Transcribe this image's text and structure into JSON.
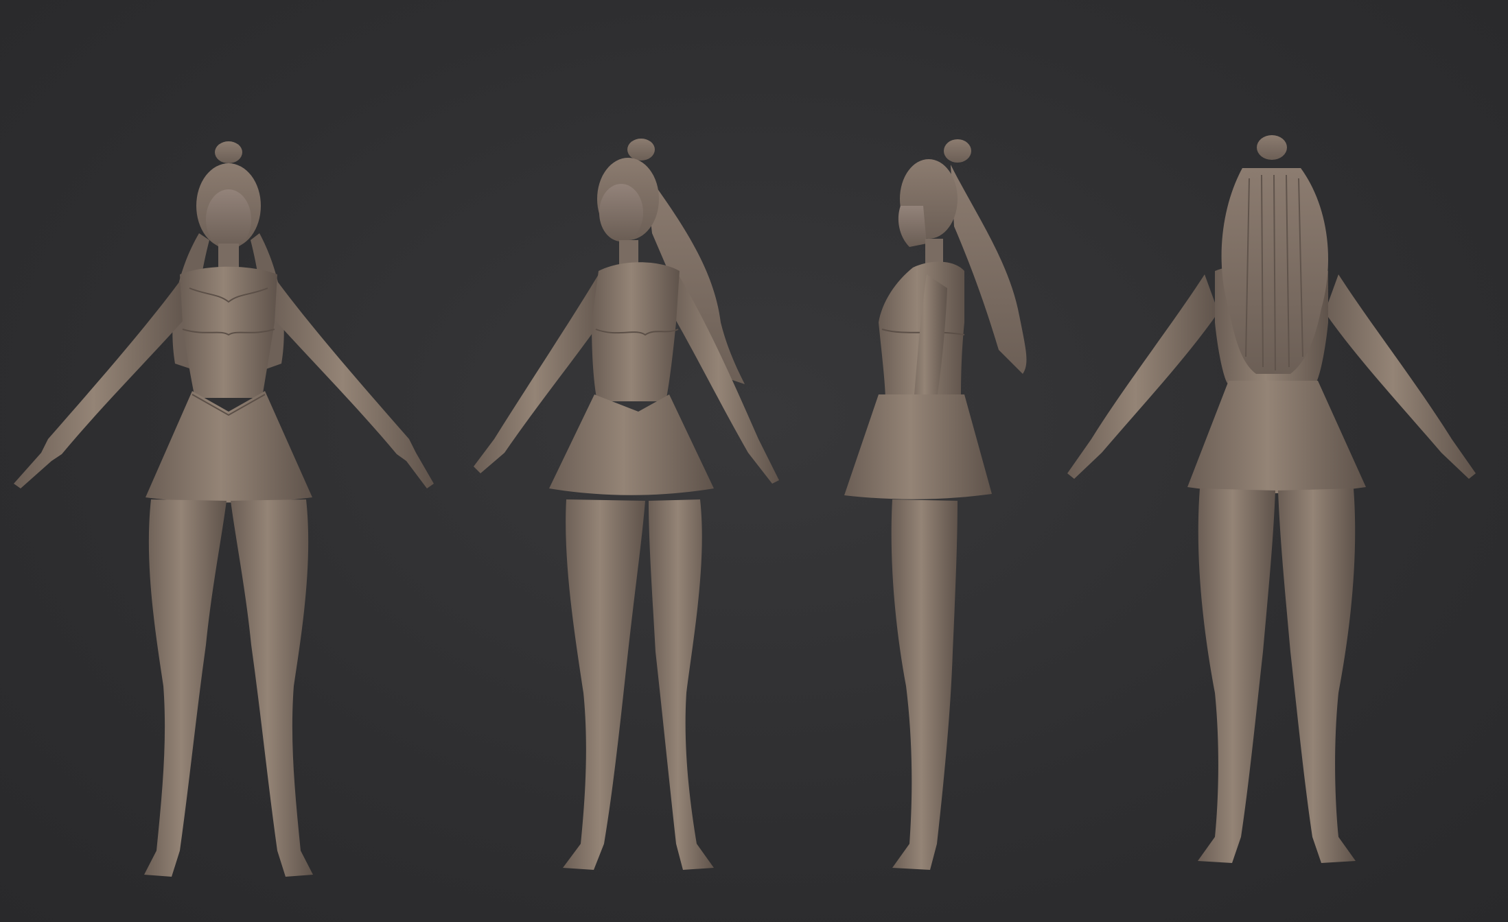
{
  "scene": {
    "description_visible_text": "",
    "background_color": "#303032",
    "clay_color": "#8a7a6e",
    "clay_shadow": "#5e5249",
    "clay_highlight": "#a39385",
    "views": [
      {
        "name": "front"
      },
      {
        "name": "three-quarter"
      },
      {
        "name": "side"
      },
      {
        "name": "back"
      }
    ]
  }
}
